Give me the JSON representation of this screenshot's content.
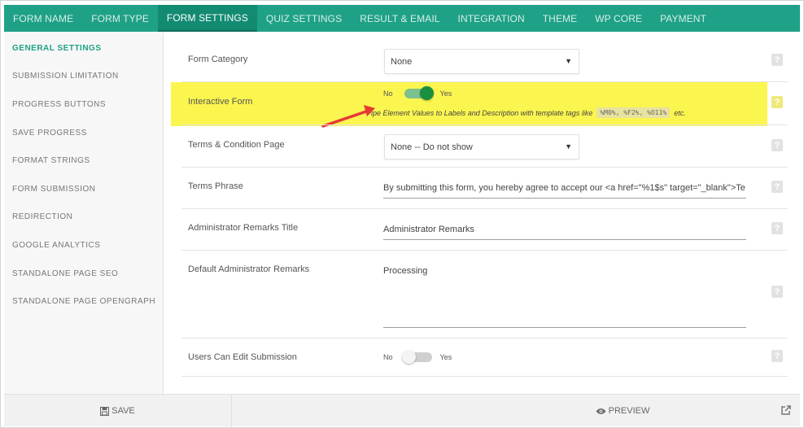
{
  "tabs": [
    {
      "label": "FORM NAME"
    },
    {
      "label": "FORM TYPE"
    },
    {
      "label": "FORM SETTINGS",
      "active": true
    },
    {
      "label": "QUIZ SETTINGS"
    },
    {
      "label": "RESULT & EMAIL"
    },
    {
      "label": "INTEGRATION"
    },
    {
      "label": "THEME"
    },
    {
      "label": "WP CORE"
    },
    {
      "label": "PAYMENT"
    }
  ],
  "sidebar": {
    "items": [
      {
        "label": "GENERAL SETTINGS"
      },
      {
        "label": "SUBMISSION LIMITATION"
      },
      {
        "label": "PROGRESS BUTTONS"
      },
      {
        "label": "SAVE PROGRESS"
      },
      {
        "label": "FORMAT STRINGS"
      },
      {
        "label": "FORM SUBMISSION"
      },
      {
        "label": "REDIRECTION"
      },
      {
        "label": "GOOGLE ANALYTICS"
      },
      {
        "label": "STANDALONE PAGE SEO"
      },
      {
        "label": "STANDALONE PAGE OPENGRAPH"
      }
    ]
  },
  "settings": {
    "form_category": {
      "label": "Form Category",
      "value": "None"
    },
    "interactive_form": {
      "label": "Interactive Form",
      "toggle_off": "No",
      "toggle_on": "Yes",
      "enabled": true,
      "note_prefix": "Pipe Element Values to Labels and Description with template tags like",
      "note_code": "%M0%, %F2%, %O11%",
      "note_suffix": "etc."
    },
    "terms_page": {
      "label": "Terms & Condition Page",
      "value": "None -- Do not show"
    },
    "terms_phrase": {
      "label": "Terms Phrase",
      "value": "By submitting this form, you hereby agree to accept our <a href=\"%1$s\" target=\"_blank\">Te"
    },
    "admin_remarks_title": {
      "label": "Administrator Remarks Title",
      "value": "Administrator Remarks"
    },
    "default_admin_remarks": {
      "label": "Default Administrator Remarks",
      "value": "Processing"
    },
    "users_can_edit": {
      "label": "Users Can Edit Submission",
      "toggle_off": "No",
      "toggle_on": "Yes",
      "enabled": false
    }
  },
  "footer": {
    "save_label": "SAVE",
    "preview_label": "PREVIEW"
  },
  "help_glyph": "?",
  "select_arrow": "▼",
  "icons": {
    "save": "floppy-disk-icon",
    "preview": "eye-icon",
    "external": "external-link-icon",
    "help": "question-mark-icon"
  },
  "colors": {
    "accent": "#1fa187",
    "accent_dark": "#138a72",
    "highlight": "#fbf54f",
    "toggle_on": "#1a8f3e",
    "toggle_on_track": "#7cc08e",
    "arrow": "#e53935"
  }
}
